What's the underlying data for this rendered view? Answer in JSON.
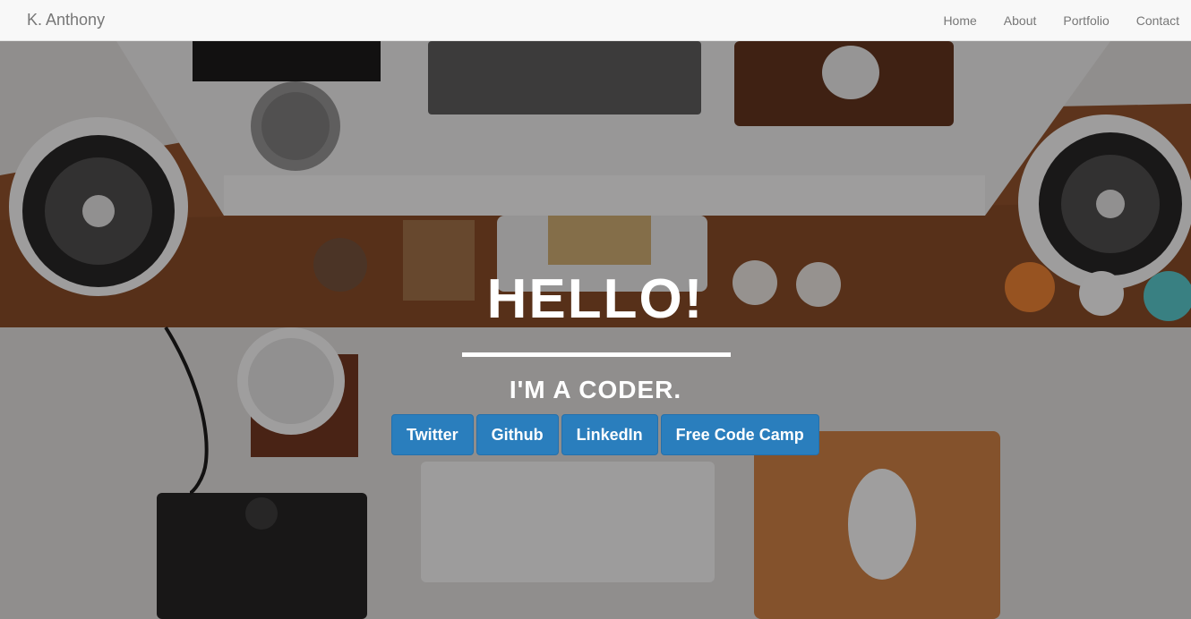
{
  "nav": {
    "brand": "K. Anthony",
    "links": [
      "Home",
      "About",
      "Portfolio",
      "Contact"
    ]
  },
  "hero": {
    "headline": "HELLO!",
    "subheadline": "I'M A CODER.",
    "buttons": [
      "Twitter",
      "Github",
      "LinkedIn",
      "Free Code Camp"
    ]
  },
  "colors": {
    "button": "#2a7ebd",
    "navbar": "#f8f8f8",
    "nav_text": "#777777"
  }
}
